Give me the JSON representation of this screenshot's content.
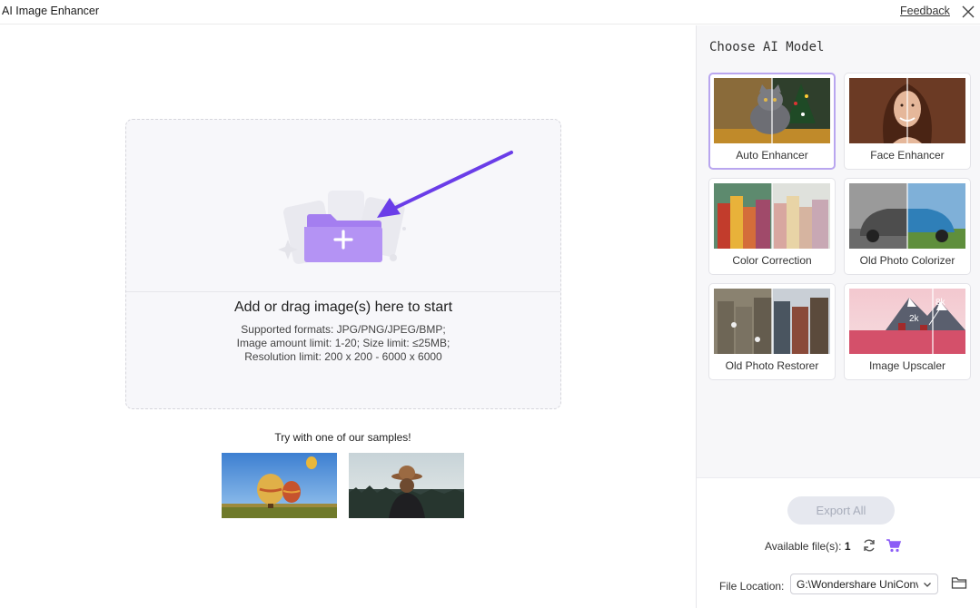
{
  "titlebar": {
    "app_title": "AI Image Enhancer",
    "feedback_label": "Feedback",
    "close_icon": "close-icon"
  },
  "dropzone": {
    "headline": "Add or drag image(s) here to start",
    "formats": "Supported formats: JPG/PNG/JPEG/BMP;",
    "limits": "Image amount limit: 1-20; Size limit: ≤25MB;",
    "resolution": "Resolution limit: 200 x 200 - 6000 x 6000",
    "illustration": "add-folder-icon",
    "accent_color": "#a47ef0",
    "arrow_color": "#6a3de8"
  },
  "samples": {
    "title": "Try with one of our samples!",
    "items": [
      {
        "name": "hot-air-balloons-sample"
      },
      {
        "name": "woman-with-hat-sample"
      }
    ]
  },
  "panel": {
    "title": "Choose AI Model",
    "models": [
      {
        "label": "Auto Enhancer",
        "selected": true
      },
      {
        "label": "Face Enhancer",
        "selected": false
      },
      {
        "label": "Color Correction",
        "selected": false
      },
      {
        "label": "Old Photo Colorizer",
        "selected": false
      },
      {
        "label": "Old Photo Restorer",
        "selected": false
      },
      {
        "label": "Image Upscaler",
        "selected": false,
        "badges": [
          "2k",
          "8k"
        ]
      }
    ]
  },
  "bottom": {
    "export_label": "Export All",
    "available_label": "Available file(s):",
    "available_count": "1",
    "file_location_label": "File Location:",
    "file_location_value": "G:\\Wondershare UniConverter",
    "selected_color": "#b9a6ef",
    "cart_color": "#8b5cf6"
  }
}
